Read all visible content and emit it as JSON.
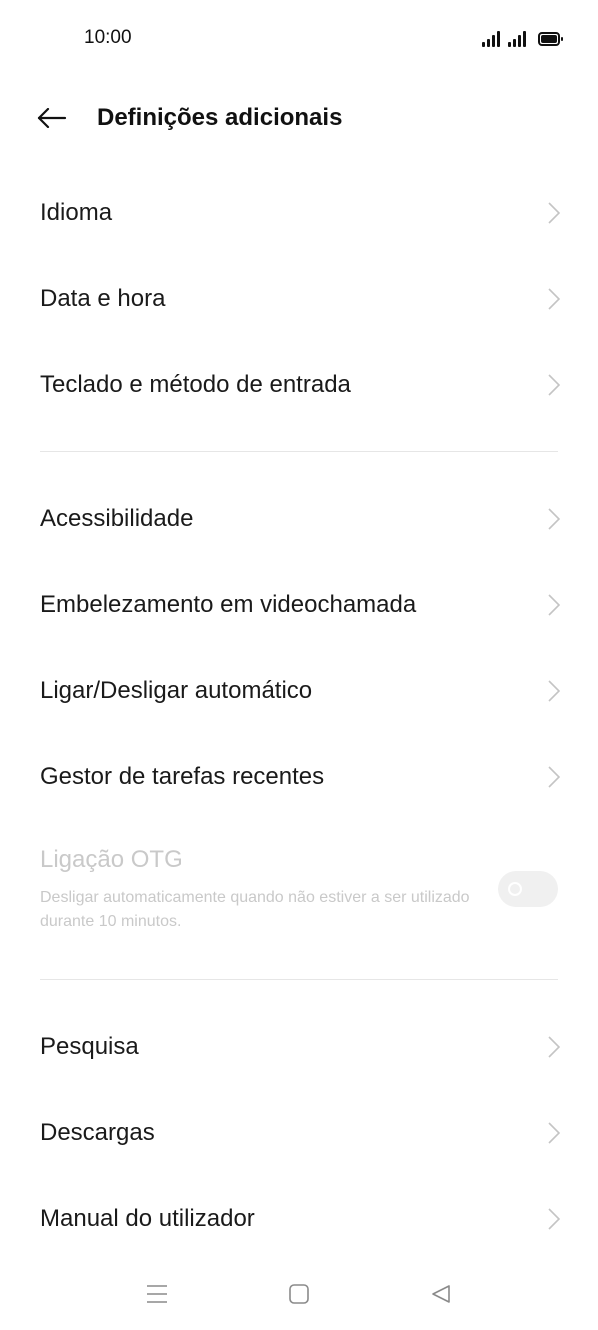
{
  "status_bar": {
    "time": "10:00"
  },
  "header": {
    "title": "Definições adicionais"
  },
  "group1": [
    {
      "label": "Idioma"
    },
    {
      "label": "Data e hora"
    },
    {
      "label": "Teclado e método de entrada"
    }
  ],
  "group2": [
    {
      "label": "Acessibilidade"
    },
    {
      "label": "Embelezamento em videochamada"
    },
    {
      "label": "Ligar/Desligar automático"
    },
    {
      "label": "Gestor de tarefas recentes"
    }
  ],
  "otg": {
    "title": "Ligação OTG",
    "description": "Desligar automaticamente quando não estiver a ser utilizado durante 10 minutos.",
    "enabled": false,
    "disabled_state": true
  },
  "group3": [
    {
      "label": "Pesquisa"
    },
    {
      "label": "Descargas"
    },
    {
      "label": "Manual do utilizador"
    }
  ],
  "icons": {
    "back": "arrow-left-icon",
    "chevron": "chevron-right-icon",
    "nav_menu": "menu-icon",
    "nav_home": "square-home-icon",
    "nav_back": "triangle-back-icon"
  },
  "colors": {
    "text": "#1a1a1a",
    "disabled_text": "#c9c9c9",
    "chevron": "#c4c4c4",
    "divider": "#e6e6e6"
  }
}
